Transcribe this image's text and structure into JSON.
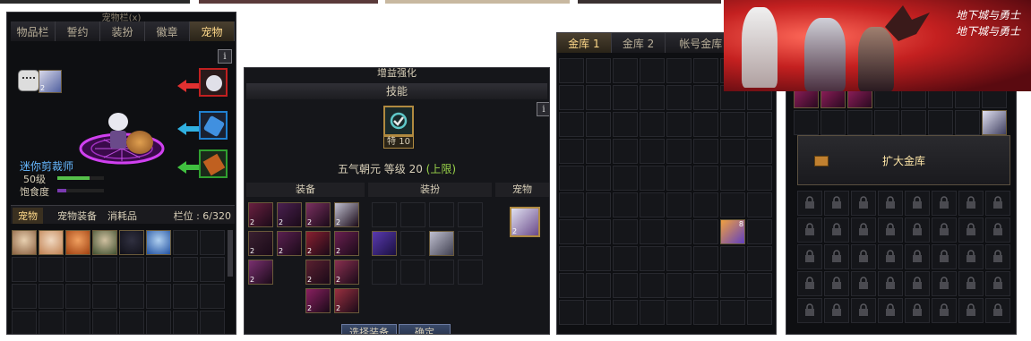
{
  "panel1": {
    "title": "宠物栏(x)",
    "tabs": [
      "物品栏",
      "誓约",
      "装扮",
      "徽章",
      "宠物"
    ],
    "pet_name": "迷你剪裁师",
    "pet_level": "50级",
    "satiety_label": "饱食度",
    "level_bar_fill": 0.7,
    "satiety_bar_fill": 0.2,
    "sub_tabs": [
      "宠物",
      "宠物装备",
      "消耗品"
    ],
    "slot_label": "栏位 : 6/320",
    "slot_number": "2",
    "pets": [
      "pet-girl-1",
      "pet-girl-2",
      "pet-boy-orange",
      "pet-bandana",
      "pet-dark-hair",
      "pet-blue-mage"
    ]
  },
  "panel2": {
    "title": "增益强化",
    "skill_header": "技能",
    "skill_badge": "特 10",
    "skill_text": "五气朝元 等级 20 ",
    "skill_suffix": "(上限)",
    "col_headers": [
      "装备",
      "装扮",
      "宠物"
    ],
    "select_button": "选择装备",
    "confirm_button": "确定",
    "item_number": "2"
  },
  "panel3": {
    "tabs": [
      "金库 1",
      "金库 2",
      "帐号金库"
    ],
    "item_number": "8"
  },
  "panel4": {
    "expand_button": "扩大金库",
    "item_number": "2"
  },
  "banner": {
    "logo_text_top": "地下城与勇士",
    "logo_text_bottom": "地下城与勇士"
  },
  "colors": {
    "accent_gold": "#ffd98a",
    "level_green": "#55c04a",
    "satiety_purple": "#7a3ab0",
    "skill_green": "#9bd54a"
  }
}
